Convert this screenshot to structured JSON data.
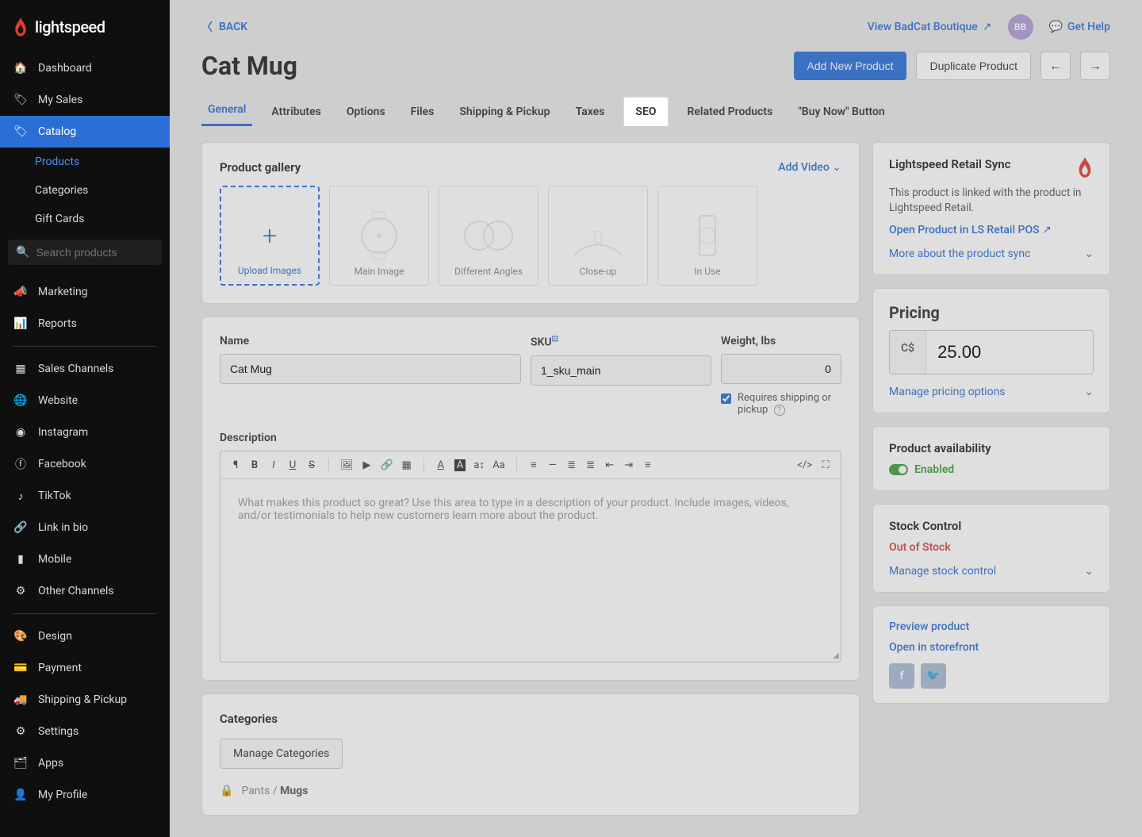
{
  "brand": "lightspeed",
  "sidebar": {
    "items": [
      {
        "icon": "home",
        "label": "Dashboard"
      },
      {
        "icon": "tag",
        "label": "My Sales"
      },
      {
        "icon": "tag-fill",
        "label": "Catalog",
        "active": true
      },
      {
        "sub": true,
        "label": "Products",
        "active_link": true
      },
      {
        "sub": true,
        "label": "Categories"
      },
      {
        "sub": true,
        "label": "Gift Cards"
      }
    ],
    "search_placeholder": "Search products",
    "groups": [
      [
        {
          "icon": "bullhorn",
          "label": "Marketing"
        },
        {
          "icon": "chart",
          "label": "Reports"
        }
      ],
      [
        {
          "icon": "grid",
          "label": "Sales Channels"
        },
        {
          "icon": "globe",
          "label": "Website"
        },
        {
          "icon": "instagram",
          "label": "Instagram"
        },
        {
          "icon": "facebook",
          "label": "Facebook"
        },
        {
          "icon": "tiktok",
          "label": "TikTok"
        },
        {
          "icon": "link",
          "label": "Link in bio"
        },
        {
          "icon": "mobile",
          "label": "Mobile"
        },
        {
          "icon": "branch",
          "label": "Other Channels"
        }
      ],
      [
        {
          "icon": "palette",
          "label": "Design"
        },
        {
          "icon": "card",
          "label": "Payment"
        },
        {
          "icon": "truck",
          "label": "Shipping & Pickup"
        },
        {
          "icon": "gear",
          "label": "Settings"
        },
        {
          "icon": "layers",
          "label": "Apps"
        },
        {
          "icon": "user",
          "label": "My Profile"
        }
      ]
    ]
  },
  "top": {
    "back": "BACK",
    "view_store": "View BadCat Boutique",
    "avatar": "BB",
    "help": "Get Help"
  },
  "page": {
    "title": "Cat Mug",
    "add_product": "Add New Product",
    "duplicate": "Duplicate Product"
  },
  "tabs": [
    "General",
    "Attributes",
    "Options",
    "Files",
    "Shipping & Pickup",
    "Taxes",
    "SEO",
    "Related Products",
    "\"Buy Now\" Button"
  ],
  "gallery": {
    "title": "Product gallery",
    "add_video": "Add Video",
    "upload": "Upload Images",
    "tiles": [
      "Main Image",
      "Different Angles",
      "Close-up",
      "In Use"
    ]
  },
  "form": {
    "name_label": "Name",
    "name_value": "Cat Mug",
    "sku_label": "SKU",
    "sku_value": "1_sku_main",
    "weight_label": "Weight, lbs",
    "weight_value": "0",
    "requires_shipping": "Requires shipping or pickup",
    "description_label": "Description",
    "description_placeholder": "What makes this product so great? Use this area to type in a description of your product. Include images, videos, and/or testimonials to help new customers learn more about the product."
  },
  "categories": {
    "title": "Categories",
    "manage": "Manage Categories",
    "path_parent": "Pants",
    "path_sep": "/",
    "path_leaf": "Mugs"
  },
  "sync": {
    "title": "Lightspeed Retail Sync",
    "text": "This product is linked with the product in Lightspeed Retail.",
    "open_link": "Open Product in LS Retail POS",
    "more": "More about the product sync"
  },
  "pricing": {
    "title": "Pricing",
    "currency": "C$",
    "value": "25.00",
    "manage": "Manage pricing options"
  },
  "availability": {
    "title": "Product availability",
    "status": "Enabled"
  },
  "stock": {
    "title": "Stock Control",
    "status": "Out of Stock",
    "manage": "Manage stock control"
  },
  "preview": {
    "preview": "Preview product",
    "open": "Open in storefront"
  }
}
